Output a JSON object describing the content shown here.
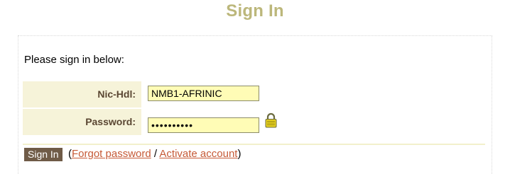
{
  "page": {
    "title": "Sign In",
    "intro": "Please sign in below:"
  },
  "form": {
    "nic_hdl": {
      "label": "Nic-Hdl:",
      "value": "NMB1-AFRINIC"
    },
    "password": {
      "label": "Password:",
      "value": "••••••••••"
    },
    "submit_label": "Sign In"
  },
  "links": {
    "open_paren": "(",
    "forgot_password": "Forgot password",
    "separator": " / ",
    "activate_account": "Activate account",
    "close_paren": ")"
  },
  "icons": {
    "lock": "padlock-icon"
  },
  "colors": {
    "title": "#bcb77b",
    "label_bg": "#f6f3d9",
    "label_text": "#5a4632",
    "input_bg": "#fffcb6",
    "button_bg": "#6f5b47",
    "link": "#c65a37"
  }
}
